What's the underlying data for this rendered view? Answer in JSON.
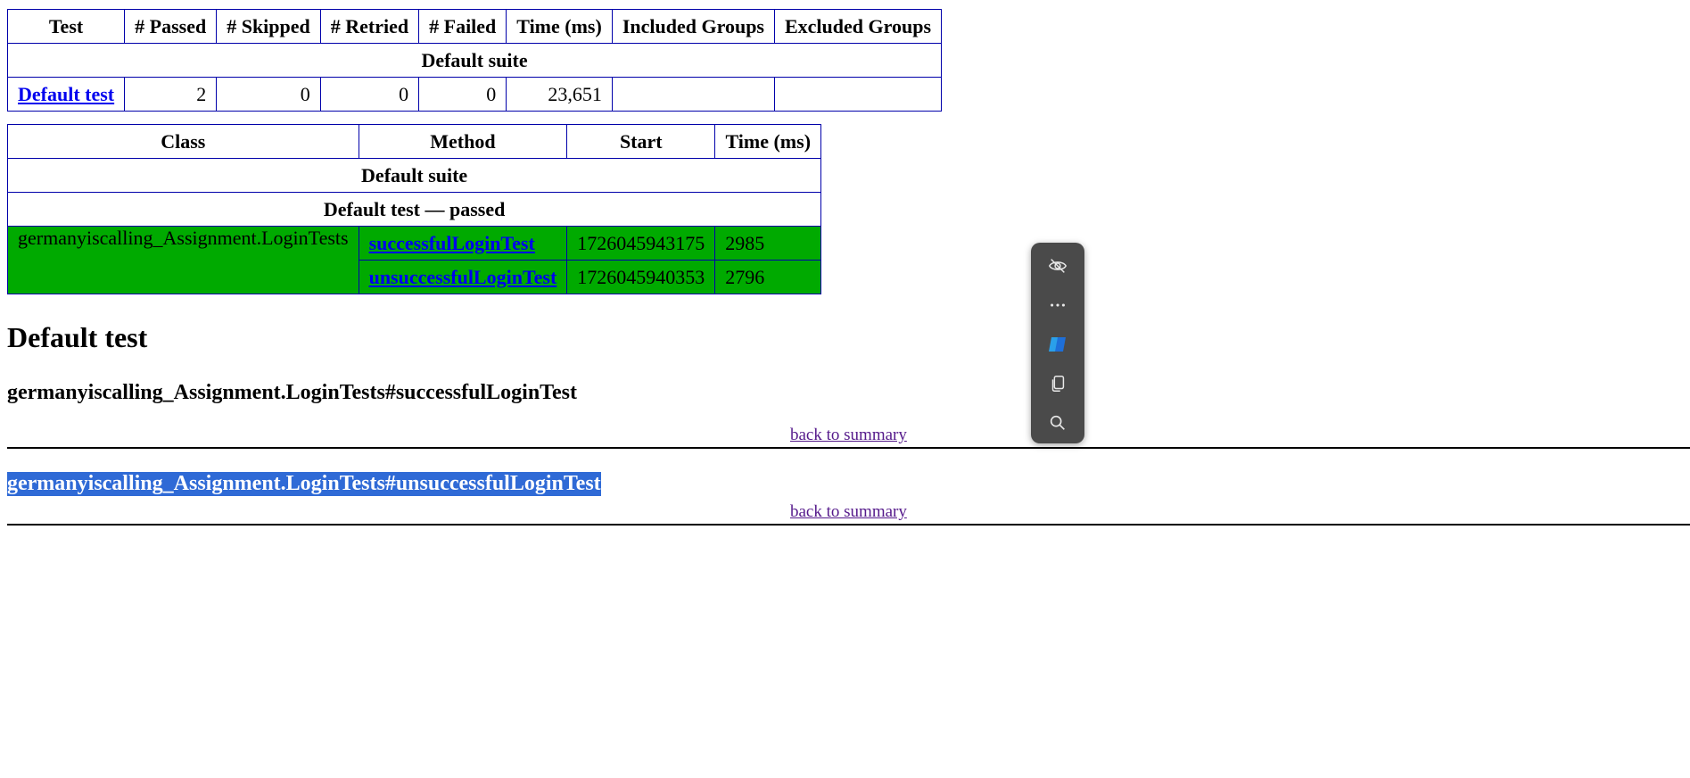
{
  "summary": {
    "headers": [
      "Test",
      "# Passed",
      "# Skipped",
      "# Retried",
      "# Failed",
      "Time (ms)",
      "Included Groups",
      "Excluded Groups"
    ],
    "suite_name": "Default suite",
    "row": {
      "test": "Default test",
      "passed": "2",
      "skipped": "0",
      "retried": "0",
      "failed": "0",
      "time": "23,651",
      "included": "",
      "excluded": ""
    }
  },
  "methods": {
    "headers": [
      "Class",
      "Method",
      "Start",
      "Time (ms)"
    ],
    "suite_name": "Default suite",
    "test_status": "Default test — passed",
    "class_name": "germanyiscalling_Assignment.LoginTests",
    "rows": [
      {
        "method": "successfulLoginTest",
        "start": "1726045943175",
        "time": "2985"
      },
      {
        "method": "unsuccessfulLoginTest",
        "start": "1726045940353",
        "time": "2796"
      }
    ],
    "status_color": "#00aa00"
  },
  "details": {
    "test_title": "Default test",
    "sections": [
      {
        "title": "germanyiscalling_Assignment.LoginTests#successfulLoginTest",
        "back": "back to summary"
      },
      {
        "title": "germanyiscalling_Assignment.LoginTests#unsuccessfulLoginTest",
        "back": "back to summary"
      }
    ]
  },
  "mini_menu": {
    "icons": [
      "eye-hidden-icon",
      "more-icon",
      "copilot-icon",
      "copy-icon",
      "search-icon"
    ]
  }
}
